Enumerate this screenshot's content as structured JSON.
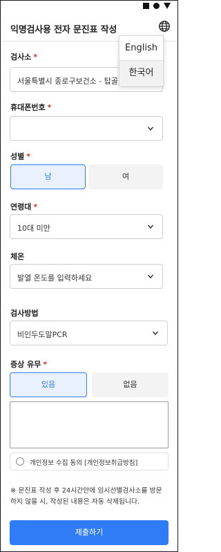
{
  "header": {
    "title": "익명검사용 전자 문진표 작성"
  },
  "language_menu": {
    "items": [
      {
        "label": "English"
      },
      {
        "label": "한국어"
      }
    ]
  },
  "form": {
    "test_site": {
      "label": "검사소",
      "value": "서울특별시 종로구보건소 - 탑골"
    },
    "phone": {
      "label": "휴대폰번호",
      "value": ""
    },
    "gender": {
      "label": "성별",
      "options": [
        "남",
        "여"
      ],
      "selected": "남"
    },
    "age": {
      "label": "연령대",
      "value": "10대 미만"
    },
    "temperature": {
      "label": "체온",
      "placeholder": "발열 온도를 입력하세요"
    },
    "method": {
      "label": "검사방법",
      "value": "비인두도말PCR"
    },
    "symptoms": {
      "label": "증상 유무",
      "options": [
        "있음",
        "없음"
      ],
      "selected": "있음",
      "text": ""
    },
    "consent": {
      "label": "개인정보 수집 동의 [개인정보취급방침]",
      "checked": false
    },
    "notice": "※ 문진표 작성 후 24시간안에 임시선별검사소를 방문하지 않을 시, 작성된 내용은 자동 삭제됩니다.",
    "submit_label": "제출하기"
  },
  "required_mark": "*",
  "colors": {
    "accent": "#2f7cf6",
    "required": "#d93025",
    "inactive_bg": "#f3f3f3"
  },
  "icons": {
    "language": "globe-icon",
    "dropdown": "chevron-down-icon"
  }
}
